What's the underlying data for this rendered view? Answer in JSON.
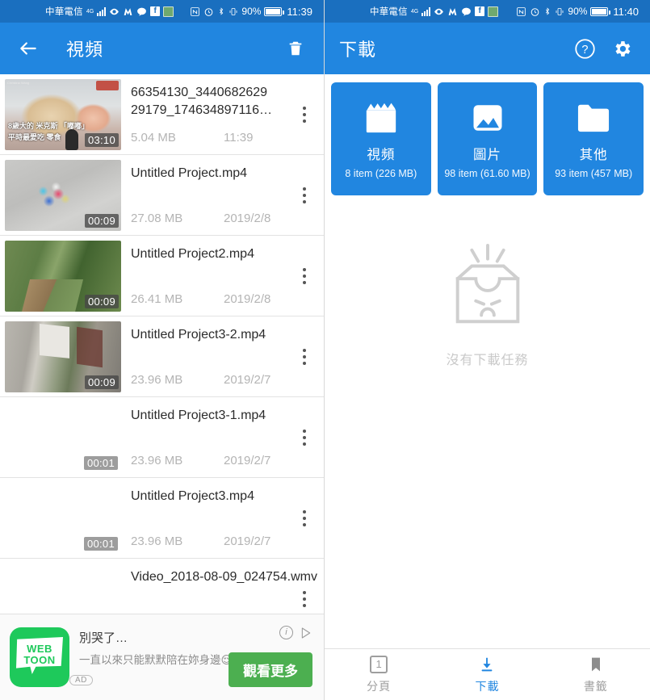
{
  "left_screen": {
    "status_bar": {
      "carrier": "中華電信",
      "network_type": "4G",
      "battery_percent": "90%",
      "time": "11:39",
      "icons": [
        "signal-bars-icon",
        "eye-icon",
        "m-app-icon",
        "chat-icon",
        "facebook-icon",
        "green-app-icon",
        "nfc-icon",
        "alarm-icon",
        "bluetooth-icon",
        "vibrate-icon",
        "battery-icon"
      ]
    },
    "app_bar": {
      "back_label": "back-arrow",
      "title": "視頻",
      "delete_label": "trash"
    },
    "videos": [
      {
        "name": "66354130_3440682629 29179_174634897116…",
        "size": "5.04 MB",
        "date": "11:39",
        "duration": "03:10",
        "thumb": "t-dog",
        "caption_line1": "8歲大的 米克斯 「嘟嘟」",
        "caption_line2": "平時最愛吃 零食",
        "watermark": "Christina Wang"
      },
      {
        "name": "Untitled Project.mp4",
        "size": "27.08 MB",
        "date": "2019/2/8",
        "duration": "00:09",
        "thumb": "t-beach"
      },
      {
        "name": "Untitled Project2.mp4",
        "size": "26.41 MB",
        "date": "2019/2/8",
        "duration": "00:09",
        "thumb": "t-forest"
      },
      {
        "name": "Untitled Project3-2.mp4",
        "size": "23.96 MB",
        "date": "2019/2/7",
        "duration": "00:09",
        "thumb": "t-road"
      },
      {
        "name": "Untitled Project3-1.mp4",
        "size": "23.96 MB",
        "date": "2019/2/7",
        "duration": "00:01",
        "thumb": "t-blank"
      },
      {
        "name": "Untitled Project3.mp4",
        "size": "23.96 MB",
        "date": "2019/2/7",
        "duration": "00:01",
        "thumb": "t-blank"
      },
      {
        "name": "Video_2018-08-09_024754.wmv",
        "size": "",
        "date": "",
        "duration": "",
        "thumb": "t-blank"
      }
    ],
    "ad": {
      "logo_line1": "WEB",
      "logo_line2": "TOON",
      "title": "別哭了…",
      "desc": "一直以來只能默默陪在妳身邊😌 這次我決定…",
      "badge": "AD",
      "cta": "觀看更多"
    }
  },
  "right_screen": {
    "status_bar": {
      "carrier": "中華電信",
      "network_type": "4G",
      "battery_percent": "90%",
      "time": "11:40"
    },
    "app_bar": {
      "title": "下載",
      "help_label": "help",
      "settings_label": "settings"
    },
    "cards": [
      {
        "icon": "clapperboard-icon",
        "label": "視頻",
        "sub": "8 item (226 MB)"
      },
      {
        "icon": "image-icon",
        "label": "圖片",
        "sub": "98 item (61.60 MB)"
      },
      {
        "icon": "folder-icon",
        "label": "其他",
        "sub": "93 item (457 MB)"
      }
    ],
    "empty_state": {
      "icon": "empty-box-sad-icon",
      "caption": "沒有下載任務"
    },
    "bottom_nav": [
      {
        "icon": "tabs-count-icon",
        "count": "1",
        "label": "分頁",
        "active": false
      },
      {
        "icon": "download-icon",
        "label": "下載",
        "active": true
      },
      {
        "icon": "bookmark-icon",
        "label": "書籤",
        "active": false
      }
    ]
  },
  "colors": {
    "accent_blue": "#2186e0",
    "status_blue": "#1a6fbf",
    "ad_green": "#4caf50",
    "logo_green": "#1ec95b",
    "muted_text": "#b4b4b4"
  }
}
